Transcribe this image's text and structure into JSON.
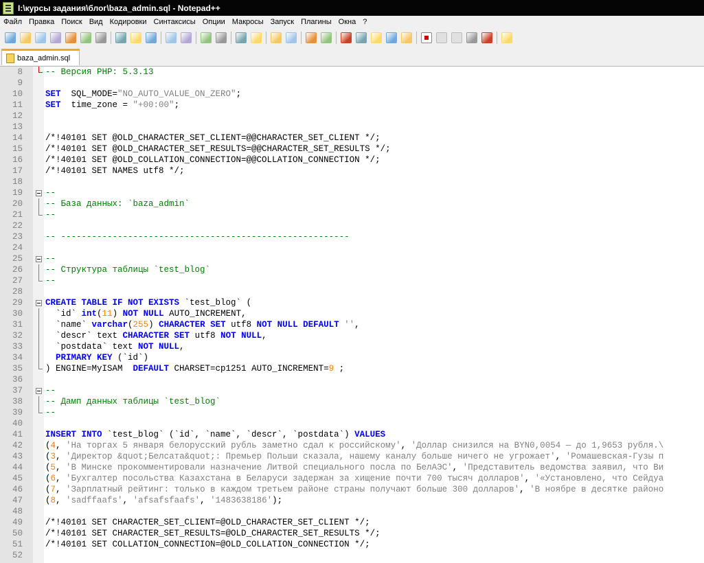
{
  "window": {
    "title": "I:\\курсы задания\\блог\\baza_admin.sql - Notepad++"
  },
  "menu": [
    "Файл",
    "Правка",
    "Поиск",
    "Вид",
    "Кодировки",
    "Синтаксисы",
    "Опции",
    "Макросы",
    "Запуск",
    "Плагины",
    "Окна",
    "?"
  ],
  "toolbar_icons": [
    "new-file-icon",
    "open-file-icon",
    "save-icon",
    "save-all-icon",
    "close-icon",
    "close-all-icon",
    "print-icon",
    "|",
    "cut-icon",
    "copy-icon",
    "paste-icon",
    "|",
    "undo-icon",
    "redo-icon",
    "|",
    "find-icon",
    "replace-icon",
    "|",
    "zoom-in-icon",
    "zoom-out-icon",
    "|",
    "sync-vertical-icon",
    "sync-horizontal-icon",
    "|",
    "word-wrap-icon",
    "show-all-chars-icon",
    "|",
    "indent-guide-icon",
    "doc-map-icon",
    "function-list-icon",
    "folder-workspace-icon",
    "monitoring-icon",
    "|",
    "record-macro-icon",
    "stop-macro-icon",
    "play-macro-icon",
    "run-macro-multiple-icon",
    "save-macro-icon",
    "|",
    "plugin-icon"
  ],
  "colors": {
    "keyword": "#0000ff",
    "string": "#808080",
    "number": "#ff8000",
    "comment": "#008000",
    "tab_accent": "#f4a62a",
    "titlebar": "#050505"
  },
  "tab": {
    "label": "baza_admin.sql"
  },
  "lines": [
    {
      "n": "8",
      "fold": "endred",
      "seg": [
        [
          "c",
          "-- Версия PHP: 5.3.13"
        ]
      ]
    },
    {
      "n": "9",
      "seg": []
    },
    {
      "n": "10",
      "seg": [
        [
          "k",
          "SET"
        ],
        [
          "",
          "  SQL_MODE="
        ],
        [
          "s",
          "\"NO_AUTO_VALUE_ON_ZERO\""
        ],
        [
          "",
          ";"
        ]
      ]
    },
    {
      "n": "11",
      "seg": [
        [
          "k",
          "SET"
        ],
        [
          "",
          "  time_zone = "
        ],
        [
          "s",
          "\"+00:00\""
        ],
        [
          "",
          ";"
        ]
      ]
    },
    {
      "n": "12",
      "seg": []
    },
    {
      "n": "13",
      "seg": []
    },
    {
      "n": "14",
      "seg": [
        [
          "",
          "/*!40101 SET @OLD_CHARACTER_SET_CLIENT=@@CHARACTER_SET_CLIENT */;"
        ]
      ]
    },
    {
      "n": "15",
      "seg": [
        [
          "",
          "/*!40101 SET @OLD_CHARACTER_SET_RESULTS=@@CHARACTER_SET_RESULTS */;"
        ]
      ]
    },
    {
      "n": "16",
      "seg": [
        [
          "",
          "/*!40101 SET @OLD_COLLATION_CONNECTION=@@COLLATION_CONNECTION */;"
        ]
      ]
    },
    {
      "n": "17",
      "seg": [
        [
          "",
          "/*!40101 SET NAMES utf8 */;"
        ]
      ]
    },
    {
      "n": "18",
      "seg": []
    },
    {
      "n": "19",
      "fold": "box",
      "seg": [
        [
          "c",
          "--"
        ]
      ]
    },
    {
      "n": "20",
      "fold": "line",
      "seg": [
        [
          "c",
          "-- База данных: `baza_admin`"
        ]
      ]
    },
    {
      "n": "21",
      "fold": "end",
      "seg": [
        [
          "c",
          "--"
        ]
      ]
    },
    {
      "n": "22",
      "seg": []
    },
    {
      "n": "23",
      "seg": [
        [
          "c",
          "-- --------------------------------------------------------"
        ]
      ]
    },
    {
      "n": "24",
      "seg": []
    },
    {
      "n": "25",
      "fold": "box",
      "seg": [
        [
          "c",
          "--"
        ]
      ]
    },
    {
      "n": "26",
      "fold": "line",
      "seg": [
        [
          "c",
          "-- Структура таблицы `test_blog`"
        ]
      ]
    },
    {
      "n": "27",
      "fold": "end",
      "seg": [
        [
          "c",
          "--"
        ]
      ]
    },
    {
      "n": "28",
      "seg": []
    },
    {
      "n": "29",
      "fold": "box",
      "seg": [
        [
          "k",
          "CREATE TABLE IF NOT EXISTS"
        ],
        [
          "",
          " `test_blog` ("
        ]
      ]
    },
    {
      "n": "30",
      "fold": "line",
      "seg": [
        [
          "",
          "  `id` "
        ],
        [
          "k",
          "int"
        ],
        [
          "",
          "("
        ],
        [
          "n",
          "11"
        ],
        [
          "",
          ") "
        ],
        [
          "k",
          "NOT NULL"
        ],
        [
          "",
          " AUTO_INCREMENT,"
        ]
      ]
    },
    {
      "n": "31",
      "fold": "line",
      "seg": [
        [
          "",
          "  `name` "
        ],
        [
          "k",
          "varchar"
        ],
        [
          "",
          "("
        ],
        [
          "n",
          "255"
        ],
        [
          "",
          ") "
        ],
        [
          "k",
          "CHARACTER SET"
        ],
        [
          "",
          " utf8 "
        ],
        [
          "k",
          "NOT NULL DEFAULT"
        ],
        [
          "",
          ""
        ],
        [
          "s",
          " ''"
        ],
        [
          "",
          ","
        ]
      ]
    },
    {
      "n": "32",
      "fold": "line",
      "seg": [
        [
          "",
          "  `descr` text "
        ],
        [
          "k",
          "CHARACTER SET"
        ],
        [
          "",
          " utf8 "
        ],
        [
          "k",
          "NOT NULL"
        ],
        [
          "",
          ","
        ]
      ]
    },
    {
      "n": "33",
      "fold": "line",
      "seg": [
        [
          "",
          "  `postdata` text "
        ],
        [
          "k",
          "NOT NULL"
        ],
        [
          "",
          ","
        ]
      ]
    },
    {
      "n": "34",
      "fold": "line",
      "seg": [
        [
          "",
          "  "
        ],
        [
          "k",
          "PRIMARY KEY"
        ],
        [
          "",
          " (`id`)"
        ]
      ]
    },
    {
      "n": "35",
      "fold": "end",
      "seg": [
        [
          "",
          ") ENGINE=MyISAM  "
        ],
        [
          "k",
          "DEFAULT"
        ],
        [
          "",
          " CHARSET=cp1251 AUTO_INCREMENT="
        ],
        [
          "n",
          "9"
        ],
        [
          "",
          " ;"
        ]
      ]
    },
    {
      "n": "36",
      "seg": []
    },
    {
      "n": "37",
      "fold": "box",
      "seg": [
        [
          "c",
          "--"
        ]
      ]
    },
    {
      "n": "38",
      "fold": "line",
      "seg": [
        [
          "c",
          "-- Дамп данных таблицы `test_blog`"
        ]
      ]
    },
    {
      "n": "39",
      "fold": "end",
      "seg": [
        [
          "c",
          "--"
        ]
      ]
    },
    {
      "n": "40",
      "seg": []
    },
    {
      "n": "41",
      "seg": [
        [
          "k",
          "INSERT INTO"
        ],
        [
          "",
          " `test_blog` (`id`, `name`, `descr`, `postdata`) "
        ],
        [
          "k",
          "VALUES"
        ]
      ]
    },
    {
      "n": "42",
      "seg": [
        [
          "",
          "("
        ],
        [
          "n",
          "4"
        ],
        [
          "",
          ", "
        ],
        [
          "s",
          "'На торгах 5 января белорусский рубль заметно сдал к российскому'"
        ],
        [
          "",
          ", "
        ],
        [
          "s",
          "'Доллар снизился на BYN0,0054 — до 1,9653 рубля.\\"
        ]
      ]
    },
    {
      "n": "43",
      "seg": [
        [
          "",
          "("
        ],
        [
          "n",
          "3"
        ],
        [
          "",
          ", "
        ],
        [
          "s",
          "'Директор &quot;Белсата&quot;: Премьер Польши сказала, нашему каналу больше ничего не угрожает'"
        ],
        [
          "",
          ", "
        ],
        [
          "s",
          "'Ромашевская-Гузы п"
        ]
      ]
    },
    {
      "n": "44",
      "seg": [
        [
          "",
          "("
        ],
        [
          "n",
          "5"
        ],
        [
          "",
          ", "
        ],
        [
          "s",
          "'В Минске прокомментировали назначение Литвой специального посла по БелАЭС'"
        ],
        [
          "",
          ", "
        ],
        [
          "s",
          "'Представитель ведомства заявил, что Ви"
        ]
      ]
    },
    {
      "n": "45",
      "seg": [
        [
          "",
          "("
        ],
        [
          "n",
          "6"
        ],
        [
          "",
          ", "
        ],
        [
          "s",
          "'Бухгалтер посольства Казахстана в Беларуси задержан за хищение почти 700 тысяч долларов'"
        ],
        [
          "",
          ", "
        ],
        [
          "s",
          "'«Установлено, что Сейдуа"
        ]
      ]
    },
    {
      "n": "46",
      "seg": [
        [
          "",
          "("
        ],
        [
          "n",
          "7"
        ],
        [
          "",
          ", "
        ],
        [
          "s",
          "'Зарплатный рейтинг: только в каждом третьем районе страны получают больше 300 долларов'"
        ],
        [
          "",
          ", "
        ],
        [
          "s",
          "'В ноябре в десятке районо"
        ]
      ]
    },
    {
      "n": "47",
      "seg": [
        [
          "",
          "("
        ],
        [
          "n",
          "8"
        ],
        [
          "",
          ", "
        ],
        [
          "s",
          "'sadffaafs'"
        ],
        [
          "",
          ", "
        ],
        [
          "s",
          "'afsafsfaafs'"
        ],
        [
          "",
          ", "
        ],
        [
          "s",
          "'1483638186'"
        ],
        [
          "",
          ");"
        ]
      ]
    },
    {
      "n": "48",
      "seg": []
    },
    {
      "n": "49",
      "seg": [
        [
          "",
          "/*!40101 SET CHARACTER_SET_CLIENT=@OLD_CHARACTER_SET_CLIENT */;"
        ]
      ]
    },
    {
      "n": "50",
      "seg": [
        [
          "",
          "/*!40101 SET CHARACTER_SET_RESULTS=@OLD_CHARACTER_SET_RESULTS */;"
        ]
      ]
    },
    {
      "n": "51",
      "seg": [
        [
          "",
          "/*!40101 SET COLLATION_CONNECTION=@OLD_COLLATION_CONNECTION */;"
        ]
      ]
    },
    {
      "n": "52",
      "seg": []
    }
  ]
}
